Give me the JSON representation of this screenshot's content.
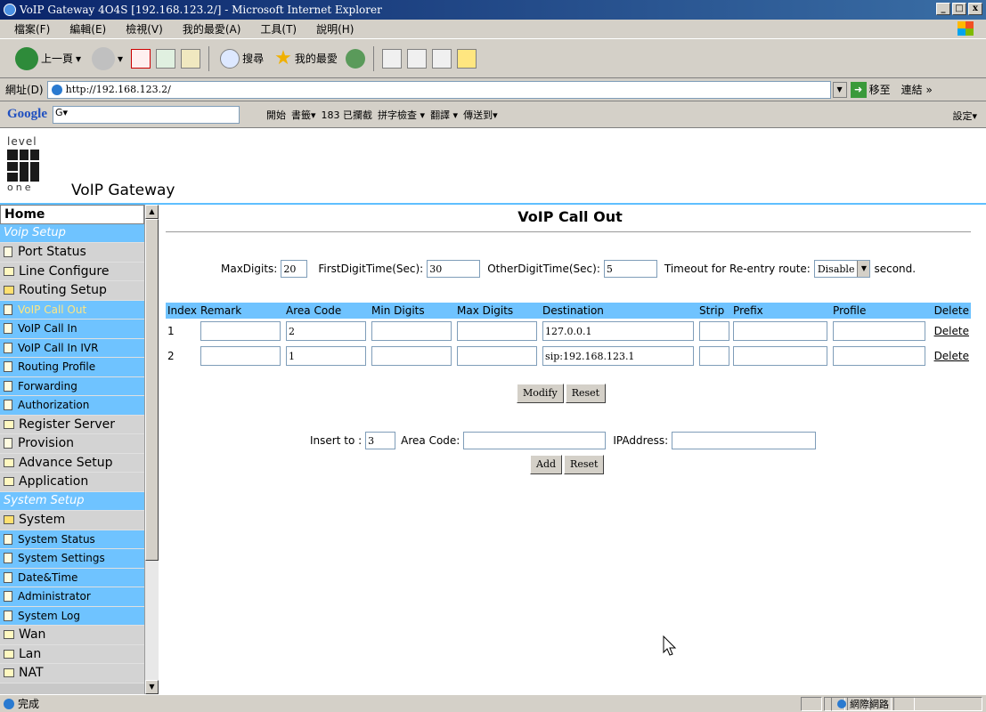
{
  "window": {
    "title": "VoIP Gateway 4O4S [192.168.123.2/] - Microsoft Internet Explorer",
    "buttons": [
      "_",
      "□",
      "x"
    ]
  },
  "menu": [
    "檔案(F)",
    "編輯(E)",
    "檢視(V)",
    "我的最愛(A)",
    "工具(T)",
    "說明(H)"
  ],
  "toolbar": {
    "back": "上一頁",
    "search": "搜尋",
    "favorites": "我的最愛"
  },
  "address": {
    "label": "網址(D)",
    "url": "http://192.168.123.2/",
    "go": "移至",
    "links": "連結 »"
  },
  "google": {
    "logo": "Google",
    "input": "G▾",
    "items": [
      "開始",
      "書籤▾",
      "183 已攔截",
      "拼字檢查 ▾",
      "翻譯 ▾",
      "傳送到▾"
    ],
    "settings": "設定▾"
  },
  "header": {
    "logo_top": "level",
    "logo_bottom": "one",
    "title": "VoIP Gateway"
  },
  "sidebar": {
    "home": "Home",
    "voip_setup": "Voip Setup",
    "port_status": "Port Status",
    "line_configure": "Line Configure",
    "routing_setup": "Routing Setup",
    "voip_call_out": "VoIP Call Out",
    "voip_call_in": "VoIP Call In",
    "voip_call_in_ivr": "VoIP Call In IVR",
    "routing_profile": "Routing Profile",
    "forwarding": "Forwarding",
    "authorization": "Authorization",
    "register_server": "Register Server",
    "provision": "Provision",
    "advance_setup": "Advance Setup",
    "application": "Application",
    "system_setup": "System Setup",
    "system": "System",
    "system_status": "System Status",
    "system_settings": "System Settings",
    "datetime": "Date&Time",
    "administrator": "Administrator",
    "system_log": "System Log",
    "wan": "Wan",
    "lan": "Lan",
    "nat": "NAT"
  },
  "main": {
    "title": "VoIP Call Out",
    "max_digits_label": "MaxDigits:",
    "max_digits": "20",
    "first_digit_label": "FirstDigitTime(Sec):",
    "first_digit": "30",
    "other_digit_label": "OtherDigitTime(Sec):",
    "other_digit": "5",
    "timeout_label": "Timeout for Re-entry route:",
    "timeout_value": "Disable",
    "timeout_unit": "second.",
    "columns": {
      "index": "Index",
      "remark": "Remark",
      "area_code": "Area Code",
      "min_digits": "Min Digits",
      "max_digits": "Max Digits",
      "destination": "Destination",
      "strip": "Strip",
      "prefix": "Prefix",
      "profile": "Profile",
      "delete": "Delete"
    },
    "rows": [
      {
        "index": "1",
        "remark": "",
        "area_code": "2",
        "min": "",
        "max": "",
        "destination": "127.0.0.1",
        "strip": "",
        "prefix": "",
        "profile": "",
        "delete": "Delete"
      },
      {
        "index": "2",
        "remark": "",
        "area_code": "1",
        "min": "",
        "max": "",
        "destination": "sip:192.168.123.1",
        "strip": "",
        "prefix": "",
        "profile": "",
        "delete": "Delete"
      }
    ],
    "modify": "Modify",
    "reset": "Reset",
    "insert_label": "Insert  to :",
    "insert_value": "3",
    "area_code_label": "Area Code:",
    "area_code_value": "",
    "ip_label": "IPAddress:",
    "ip_value": "",
    "add": "Add",
    "reset2": "Reset"
  },
  "status": {
    "text": "完成",
    "zone": "網際網路"
  }
}
